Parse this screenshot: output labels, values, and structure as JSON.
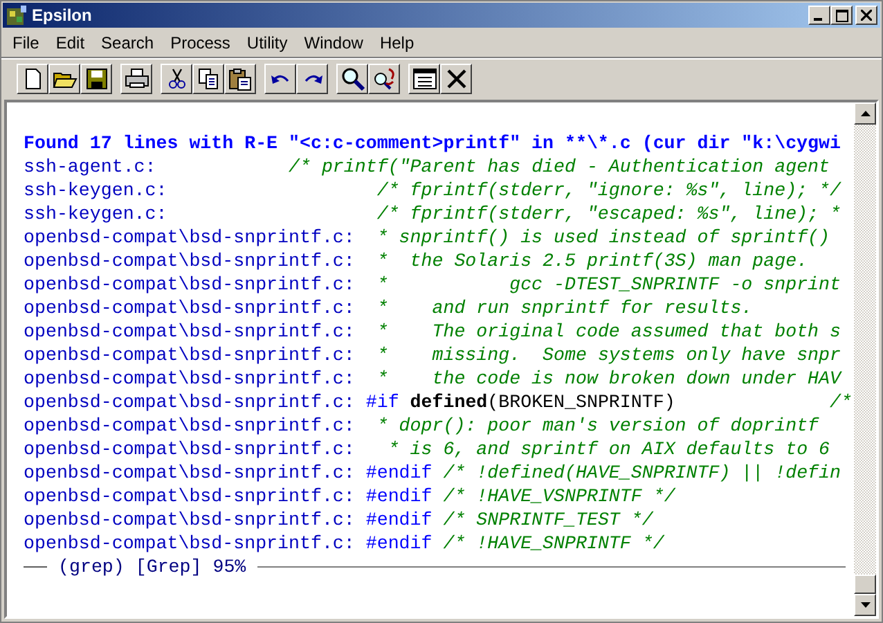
{
  "window": {
    "title": "Epsilon"
  },
  "menu": [
    "File",
    "Edit",
    "Search",
    "Process",
    "Utility",
    "Window",
    "Help"
  ],
  "lines": [
    {
      "segments": [
        {
          "kind": "header",
          "text": "Found 17 lines with R-E \"<c:c-comment>printf\" in **\\*.c (cur dir \"k:\\cygwi"
        }
      ]
    },
    {
      "segments": [
        {
          "kind": "file",
          "text": "ssh-agent.c:"
        },
        {
          "kind": "comment",
          "text": "            /* printf(\"Parent has died - Authentication agent"
        }
      ]
    },
    {
      "segments": [
        {
          "kind": "file",
          "text": "ssh-keygen.c:"
        },
        {
          "kind": "comment",
          "text": "                   /* fprintf(stderr, \"ignore: %s\", line); */"
        }
      ]
    },
    {
      "segments": [
        {
          "kind": "file",
          "text": "ssh-keygen.c:"
        },
        {
          "kind": "comment",
          "text": "                   /* fprintf(stderr, \"escaped: %s\", line); *"
        }
      ]
    },
    {
      "segments": [
        {
          "kind": "file",
          "text": "openbsd-compat\\bsd-snprintf.c:"
        },
        {
          "kind": "comment",
          "text": "  * snprintf() is used instead of sprintf()"
        }
      ]
    },
    {
      "segments": [
        {
          "kind": "file",
          "text": "openbsd-compat\\bsd-snprintf.c:"
        },
        {
          "kind": "comment",
          "text": "  *  the Solaris 2.5 printf(3S) man page."
        }
      ]
    },
    {
      "segments": [
        {
          "kind": "file",
          "text": "openbsd-compat\\bsd-snprintf.c:"
        },
        {
          "kind": "comment",
          "text": "  *           gcc -DTEST_SNPRINTF -o snprint"
        }
      ]
    },
    {
      "segments": [
        {
          "kind": "file",
          "text": "openbsd-compat\\bsd-snprintf.c:"
        },
        {
          "kind": "comment",
          "text": "  *    and run snprintf for results."
        }
      ]
    },
    {
      "segments": [
        {
          "kind": "file",
          "text": "openbsd-compat\\bsd-snprintf.c:"
        },
        {
          "kind": "comment",
          "text": "  *    The original code assumed that both s"
        }
      ]
    },
    {
      "segments": [
        {
          "kind": "file",
          "text": "openbsd-compat\\bsd-snprintf.c:"
        },
        {
          "kind": "comment",
          "text": "  *    missing.  Some systems only have snpr"
        }
      ]
    },
    {
      "segments": [
        {
          "kind": "file",
          "text": "openbsd-compat\\bsd-snprintf.c:"
        },
        {
          "kind": "comment",
          "text": "  *    the code is now broken down under HAV"
        }
      ]
    },
    {
      "segments": [
        {
          "kind": "file",
          "text": "openbsd-compat\\bsd-snprintf.c:"
        },
        {
          "kind": "keyword",
          "text": " #if "
        },
        {
          "kind": "bold",
          "text": "defined"
        },
        {
          "kind": "plain",
          "text": "(BROKEN_SNPRINTF)"
        },
        {
          "kind": "comment",
          "text": "              /*"
        }
      ]
    },
    {
      "segments": [
        {
          "kind": "file",
          "text": "openbsd-compat\\bsd-snprintf.c:"
        },
        {
          "kind": "comment",
          "text": "  * dopr(): poor man's version of doprintf"
        }
      ]
    },
    {
      "segments": [
        {
          "kind": "file",
          "text": "openbsd-compat\\bsd-snprintf.c:"
        },
        {
          "kind": "comment",
          "text": "   * is 6, and sprintf on AIX defaults to 6"
        }
      ]
    },
    {
      "segments": [
        {
          "kind": "file",
          "text": "openbsd-compat\\bsd-snprintf.c:"
        },
        {
          "kind": "keyword",
          "text": " #endif"
        },
        {
          "kind": "comment",
          "text": " /* !defined(HAVE_SNPRINTF) || !defin"
        }
      ]
    },
    {
      "segments": [
        {
          "kind": "file",
          "text": "openbsd-compat\\bsd-snprintf.c:"
        },
        {
          "kind": "keyword",
          "text": " #endif"
        },
        {
          "kind": "comment",
          "text": " /* !HAVE_VSNPRINTF */"
        }
      ]
    },
    {
      "segments": [
        {
          "kind": "file",
          "text": "openbsd-compat\\bsd-snprintf.c:"
        },
        {
          "kind": "keyword",
          "text": " #endif"
        },
        {
          "kind": "comment",
          "text": " /* SNPRINTF_TEST */"
        }
      ]
    },
    {
      "segments": [
        {
          "kind": "file",
          "text": "openbsd-compat\\bsd-snprintf.c:"
        },
        {
          "kind": "keyword",
          "text": " #endif"
        },
        {
          "kind": "comment",
          "text": " /* !HAVE_SNPRINTF */"
        }
      ]
    }
  ],
  "mode_line": "(grep) [Grep] 95%"
}
